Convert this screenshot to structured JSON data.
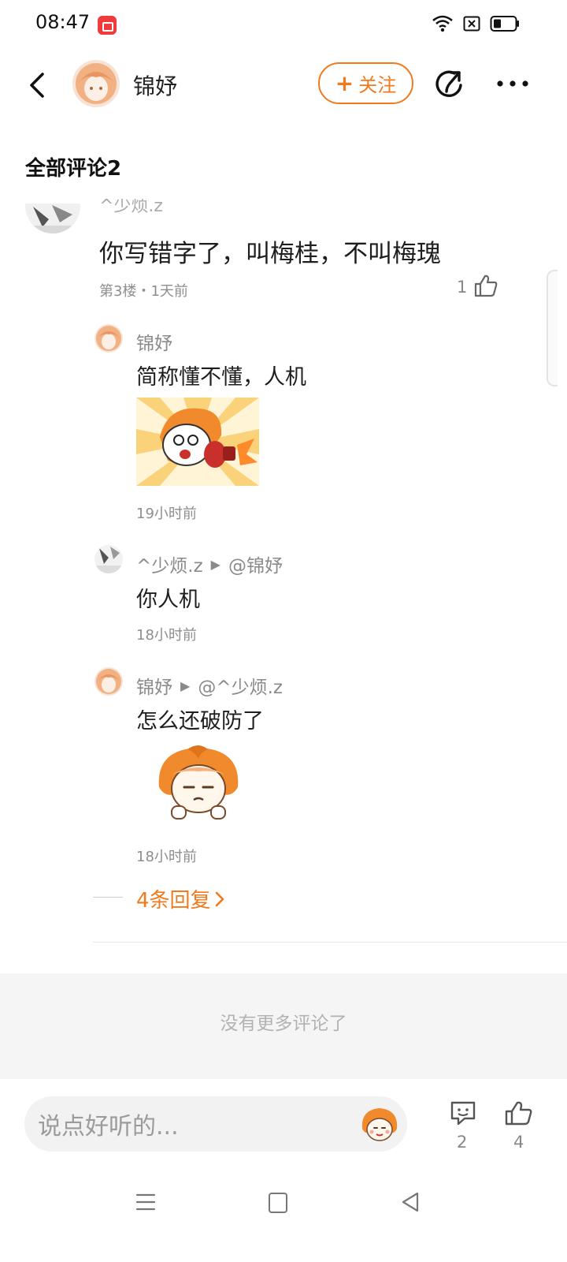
{
  "status_bar": {
    "time": "08:47",
    "icons": [
      "screen-record-icon",
      "wifi-icon",
      "sim-icon",
      "battery-icon"
    ]
  },
  "header": {
    "author_name": "锦妤",
    "follow_label": "关注",
    "icons": [
      "back-icon",
      "share-icon",
      "more-icon"
    ]
  },
  "section": {
    "title": "全部评论2"
  },
  "comment": {
    "author_partial": "^少烦.z",
    "text": "你写错字了，叫梅桂，不叫梅瑰",
    "meta": "第3楼・1天前",
    "like_count": "1",
    "replies": [
      {
        "author": "锦妤",
        "reply_to": "",
        "text": "简称懂不懂，人机",
        "has_sticker": true,
        "time": "19小时前"
      },
      {
        "author": "^少烦.z",
        "reply_to": "@锦妤",
        "text": "你人机",
        "has_sticker": false,
        "time": "18小时前"
      },
      {
        "author": "锦妤",
        "reply_to": "@^少烦.z",
        "text": "怎么还破防了",
        "has_sticker": true,
        "time": "18小时前"
      }
    ],
    "more_replies_label": "4条回复"
  },
  "end_of_list": "没有更多评论了",
  "bottom_bar": {
    "input_placeholder": "说点好听的...",
    "comment_count": "2",
    "like_count": "4"
  },
  "colors": {
    "accent": "#f07a1d",
    "text_primary": "#1e1e1e",
    "text_secondary": "#8a8a8a",
    "background": "#ffffff"
  }
}
